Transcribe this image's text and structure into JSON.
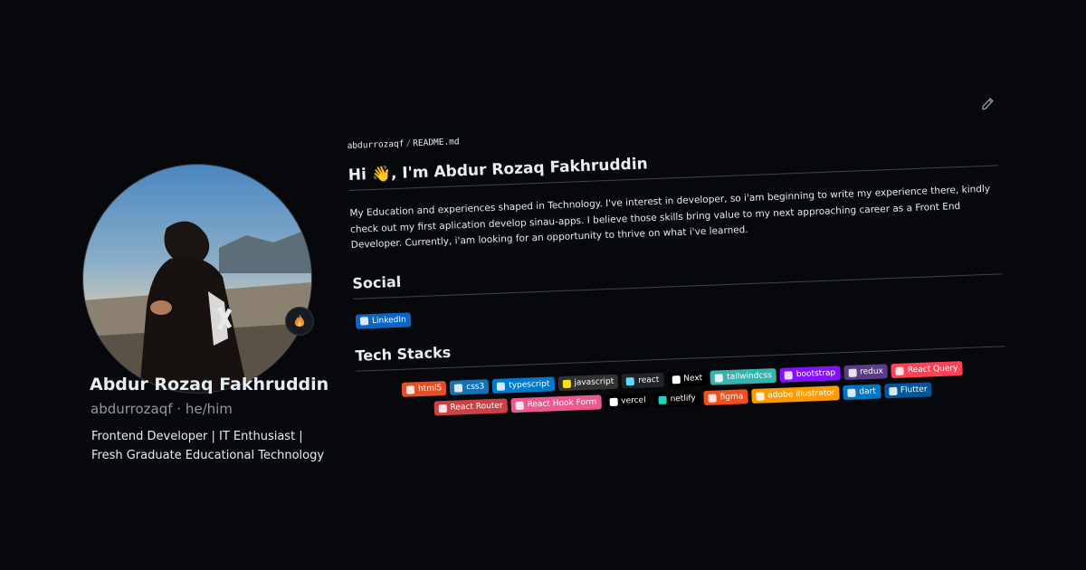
{
  "profile": {
    "name": "Abdur Rozaq Fakhruddin",
    "handle": "abdurrozaqf · he/him",
    "bio": "Frontend Developer | IT Enthusiast | Fresh Graduate Educational Technology",
    "status_icon": "fire-icon"
  },
  "readme": {
    "breadcrumb": {
      "owner": "abdurrozaqf",
      "separator": "/",
      "file": "README.md"
    },
    "greeting_prefix": "Hi",
    "greeting_emoji": "👋",
    "greeting_suffix": ", I'm Abdur Rozaq Fakhruddin",
    "intro": "My Education and experiences shaped in Technology. I've interest in developer, so i'am beginning to write my experience there, kindly check out my first aplication develop sinau-apps. I believe those skills bring value to my next approaching career as a Front End Developer. Currently, i'am looking for an opportunity to thrive on what i've learned.",
    "social_heading": "Social",
    "social": [
      {
        "label": "LinkedIn",
        "color": "#0a66c2",
        "icon": "linkedin-icon"
      }
    ],
    "tech_heading": "Tech Stacks",
    "tech_row1": [
      {
        "label": "html5",
        "color": "#e34f26",
        "icon": "html5-icon"
      },
      {
        "label": "css3",
        "color": "#1572b6",
        "icon": "css3-icon"
      },
      {
        "label": "typescript",
        "color": "#007acc",
        "icon": "typescript-icon"
      },
      {
        "label": "javascript",
        "color": "#323330",
        "icon": "javascript-icon",
        "icon_color": "#f7df1e"
      },
      {
        "label": "react",
        "color": "#20232a",
        "icon": "react-icon",
        "icon_color": "#61dafb"
      },
      {
        "label": "Next",
        "color": "#000000",
        "icon": "next-icon",
        "icon_color": "#ffffff"
      },
      {
        "label": "tailwindcss",
        "color": "#38b2ac",
        "icon": "tailwind-icon"
      },
      {
        "label": "bootstrap",
        "color": "#8511fa",
        "icon": "bootstrap-icon"
      },
      {
        "label": "redux",
        "color": "#593d88",
        "icon": "redux-icon"
      },
      {
        "label": "React Query",
        "color": "#ff4154",
        "icon": "react-query-icon"
      }
    ],
    "tech_row2": [
      {
        "label": "React Router",
        "color": "#ca4245",
        "icon": "react-router-icon"
      },
      {
        "label": "React Hook Form",
        "color": "#ec5990",
        "icon": "react-hook-form-icon"
      },
      {
        "label": "vercel",
        "color": "#000000",
        "icon": "vercel-icon",
        "icon_color": "#ffffff"
      },
      {
        "label": "netlify",
        "color": "#000000",
        "icon": "netlify-icon",
        "icon_color": "#24d1c1"
      },
      {
        "label": "figma",
        "color": "#f24e1e",
        "icon": "figma-icon"
      },
      {
        "label": "adobe illustrator",
        "color": "#ff9a00",
        "icon": "illustrator-icon"
      },
      {
        "label": "dart",
        "color": "#0175c2",
        "icon": "dart-icon"
      },
      {
        "label": "Flutter",
        "color": "#02569b",
        "icon": "flutter-icon"
      }
    ]
  },
  "colors": {
    "background": "#07080b",
    "text": "#e6edf3",
    "muted": "#9198a1",
    "rule": "#3d444d"
  }
}
